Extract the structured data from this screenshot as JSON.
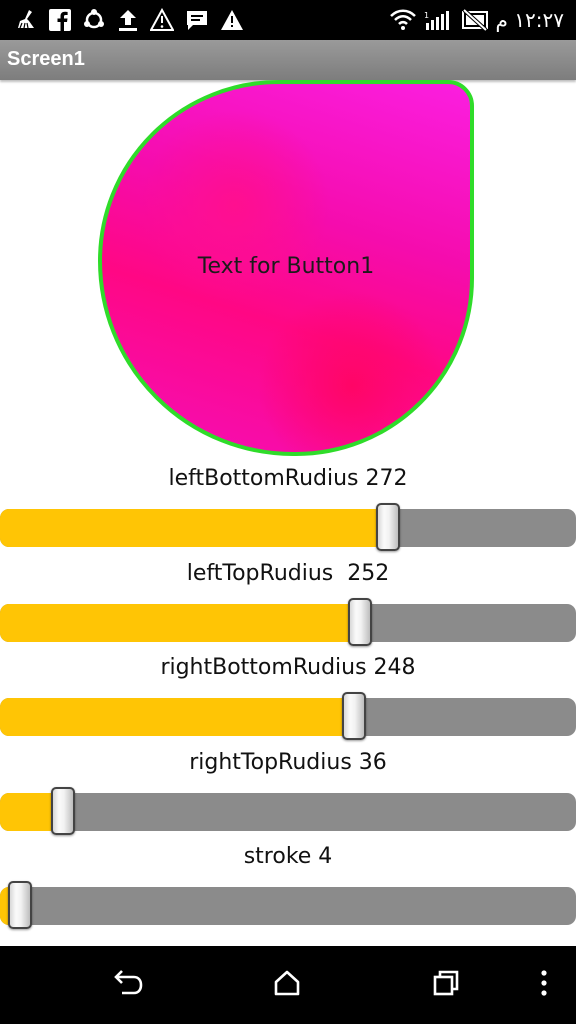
{
  "status_bar": {
    "time": "١٢:٢٧ م"
  },
  "screen": {
    "title": "Screen1"
  },
  "drop_button": {
    "label": "Text for Button1",
    "fill_colors": [
      "#fb1ee0",
      "#ff0784"
    ],
    "stroke_color": "#2fdc2a"
  },
  "sliders": [
    {
      "label": "leftBottomRudius 272",
      "fraction": 0.674
    },
    {
      "label": "leftTopRudius  252",
      "fraction": 0.625
    },
    {
      "label": "rightBottomRudius 248",
      "fraction": 0.615
    },
    {
      "label": "rightTopRudius 36",
      "fraction": 0.109
    },
    {
      "label": "stroke 4",
      "fraction": 0.034
    }
  ],
  "colors": {
    "slider_fill": "#ffc505",
    "slider_track": "#8b8b8b",
    "action_bar": "#8a8a8a"
  },
  "icons": {
    "status_left": [
      "broom-icon",
      "facebook-icon",
      "sync-icon",
      "upload-icon",
      "warning-outline-icon",
      "message-icon",
      "warning-icon"
    ],
    "status_right": [
      "wifi-icon",
      "signal-icon",
      "no-sim-icon"
    ],
    "nav": [
      "back-icon",
      "home-icon",
      "recent-apps-icon",
      "overflow-menu-icon"
    ]
  }
}
